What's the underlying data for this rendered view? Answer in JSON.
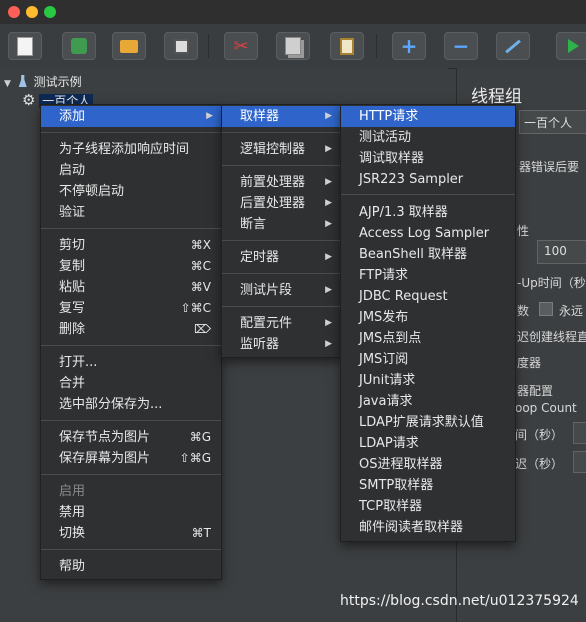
{
  "tree": {
    "root_label": "测试示例",
    "child_label": "一百个人"
  },
  "right_panel": {
    "title": "线程组",
    "name_value": "一百个人",
    "error_fragment": "器错误后要",
    "props_fragment": "性",
    "threads_value": "100",
    "rampup_fragment": "-Up时间（秒",
    "loop_fragment": "数",
    "forever_label": "永远",
    "delay_fragment": "迟创建线程直",
    "scheduler_fragment": "度器",
    "config_fragment": "器配置",
    "loop_count_fragment": "oop Count",
    "duration_fragment": "间（秒）",
    "startup_fragment": "迟（秒）"
  },
  "menu_main": {
    "items": [
      {
        "label": "添加",
        "submenu": true
      },
      {
        "label": "为子线程添加响应时间"
      },
      {
        "label": "启动"
      },
      {
        "label": "不停顿启动"
      },
      {
        "label": "验证"
      },
      {
        "label": "剪切",
        "shortcut": "⌘X"
      },
      {
        "label": "复制",
        "shortcut": "⌘C"
      },
      {
        "label": "粘贴",
        "shortcut": "⌘V"
      },
      {
        "label": "复写",
        "shortcut": "⇧⌘C"
      },
      {
        "label": "删除",
        "shortcut": "⌦"
      },
      {
        "label": "打开..."
      },
      {
        "label": "合并"
      },
      {
        "label": "选中部分保存为..."
      },
      {
        "label": "保存节点为图片",
        "shortcut": "⌘G"
      },
      {
        "label": "保存屏幕为图片",
        "shortcut": "⇧⌘G"
      },
      {
        "label": "启用"
      },
      {
        "label": "禁用"
      },
      {
        "label": "切换",
        "shortcut": "⌘T"
      },
      {
        "label": "帮助"
      }
    ]
  },
  "menu_add": {
    "items": [
      {
        "label": "取样器"
      },
      {
        "label": "逻辑控制器"
      },
      {
        "label": "前置处理器"
      },
      {
        "label": "后置处理器"
      },
      {
        "label": "断言"
      },
      {
        "label": "定时器"
      },
      {
        "label": "测试片段"
      },
      {
        "label": "配置元件"
      },
      {
        "label": "监听器"
      }
    ]
  },
  "menu_sampler": {
    "items": [
      "HTTP请求",
      "测试活动",
      "调试取样器",
      "JSR223 Sampler",
      "AJP/1.3 取样器",
      "Access Log Sampler",
      "BeanShell 取样器",
      "FTP请求",
      "JDBC Request",
      "JMS发布",
      "JMS点到点",
      "JMS订阅",
      "JUnit请求",
      "Java请求",
      "LDAP扩展请求默认值",
      "LDAP请求",
      "OS进程取样器",
      "SMTP取样器",
      "TCP取样器",
      "邮件阅读者取样器"
    ]
  },
  "watermark": "https://blog.csdn.net/u012375924",
  "colors": {
    "selection": "#2f65ca",
    "menu_bg": "#2e3032",
    "panel_bg": "#3c3f41"
  }
}
